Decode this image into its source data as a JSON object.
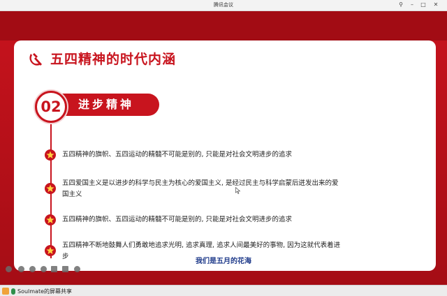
{
  "window": {
    "title": "腾讯会议"
  },
  "slide": {
    "heading": "五四精神的时代内涵",
    "section_number": "02",
    "section_label": "进步精神",
    "items": [
      {
        "text": "五四精神的旗帜、五四运动的精髓不可能是别的, 只能是对社会文明进步的追求"
      },
      {
        "text": "五四爱国主义是以进步的科学与民主为核心的爱国主义, 是经过民主与科学启蒙后迸发出来的爱国主义"
      },
      {
        "text": "五四精神的旗帜、五四运动的精髓不可能是别的, 只能是对社会文明进步的追求"
      },
      {
        "text": "五四精神不断地鼓舞人们勇敢地追求光明, 追求真理, 追求人间最美好的事物, 因为这就代表着进步"
      }
    ]
  },
  "caption": "我们是五月的花海",
  "share_status": {
    "label": "Soulmate的屏幕共享"
  },
  "colors": {
    "accent_red": "#c8141e",
    "caption_blue": "#1e3a8a"
  },
  "icons": {
    "emblem": "hammer-sickle-icon",
    "bullet": "star-icon",
    "window_controls": [
      "pin-icon",
      "minimize-icon",
      "maximize-icon",
      "close-icon"
    ]
  }
}
